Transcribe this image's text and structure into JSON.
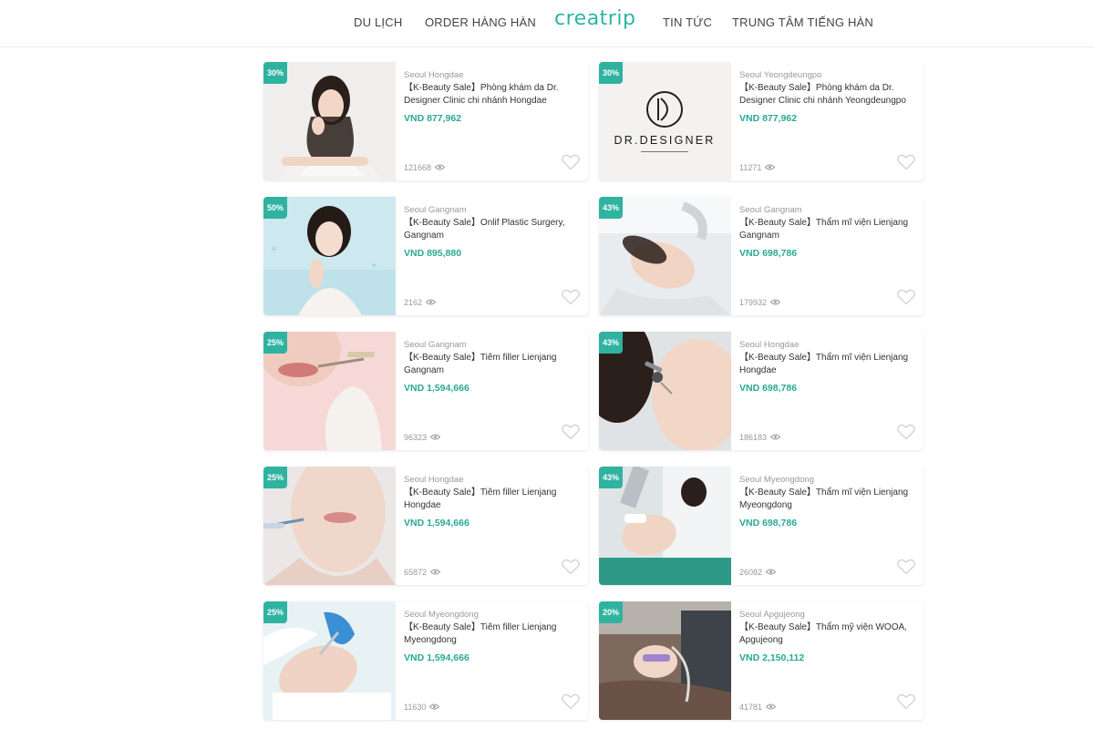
{
  "header": {
    "nav_left": [
      "DU LỊCH",
      "ORDER HÀNG HÀN"
    ],
    "logo": "creatrip",
    "nav_right": [
      "TIN TỨC",
      "TRUNG TÂM TIẾNG HÀN"
    ]
  },
  "colors": {
    "accent": "#2bb5a0",
    "price": "#28a896",
    "badge": "#2fb3a0"
  },
  "cards": [
    {
      "discount": "30%",
      "location": "Seoul Hongdae",
      "title": "【K-Beauty Sale】Phòng khám da Dr. Designer Clinic chi nhánh Hongdae",
      "price": "VND 877,962",
      "views": "121668",
      "image": "model-portrait"
    },
    {
      "discount": "30%",
      "location": "Seoul Yeongdeungpo",
      "title": "【K-Beauty Sale】Phòng khám da Dr. Designer Clinic chi nhánh Yeongdeungpo",
      "price": "VND 877,962",
      "views": "11271",
      "image": "dr-designer-logo",
      "logo_text": "DR.DESIGNER"
    },
    {
      "discount": "50%",
      "location": "Seoul Gangnam",
      "title": "【K-Beauty Sale】Onlif Plastic Surgery, Gangnam",
      "price": "VND 895,880",
      "views": "2162",
      "image": "model-blue-background"
    },
    {
      "discount": "43%",
      "location": "Seoul Gangnam",
      "title": "【K-Beauty Sale】Thẩm mĩ viện Lienjang Gangnam",
      "price": "VND 698,786",
      "views": "179932",
      "image": "facial-treatment"
    },
    {
      "discount": "25%",
      "location": "Seoul Gangnam",
      "title": "【K-Beauty Sale】Tiêm filler Lienjang Gangnam",
      "price": "VND 1,594,666",
      "views": "96323",
      "image": "lip-filler"
    },
    {
      "discount": "43%",
      "location": "Seoul Hongdae",
      "title": "【K-Beauty Sale】Thẩm mĩ viện Lienjang Hongdae",
      "price": "VND 698,786",
      "views": "186183",
      "image": "skin-dropper"
    },
    {
      "discount": "25%",
      "location": "Seoul Hongdae",
      "title": "【K-Beauty Sale】Tiêm filler Lienjang Hongdae",
      "price": "VND 1,594,666",
      "views": "65872",
      "image": "chin-filler"
    },
    {
      "discount": "43%",
      "location": "Seoul Myeongdong",
      "title": "【K-Beauty Sale】Thẩm mĩ viện Lienjang Myeongdong",
      "price": "VND 698,786",
      "views": "26082",
      "image": "doctor-procedure"
    },
    {
      "discount": "25%",
      "location": "Seoul Myeongdong",
      "title": "【K-Beauty Sale】Tiêm filler Lienjang Myeongdong",
      "price": "VND 1,594,666",
      "views": "11630",
      "image": "filler-injection"
    },
    {
      "discount": "20%",
      "location": "Seoul Apgujeong",
      "title": "【K-Beauty Sale】Thẩm mỹ viện WOOA, Apgujeong",
      "price": "VND 2,150,112",
      "views": "41781",
      "image": "device-treatment"
    }
  ]
}
